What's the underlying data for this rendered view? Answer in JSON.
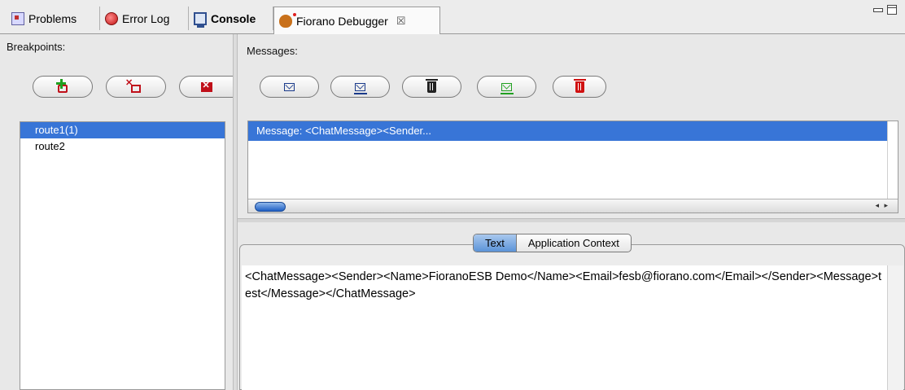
{
  "tabs": [
    {
      "label": "Problems",
      "icon": "problems-icon"
    },
    {
      "label": "Error Log",
      "icon": "error-log-icon"
    },
    {
      "label": "Console",
      "icon": "console-icon"
    },
    {
      "label": "Fiorano Debugger",
      "icon": "debugger-icon",
      "close": "☒"
    }
  ],
  "breakpoints": {
    "label": "Breakpoints:",
    "buttons": [
      "add-breakpoint-icon",
      "remove-breakpoint-icon",
      "remove-all-breakpoints-icon"
    ],
    "items": [
      "route1(1)",
      "route2"
    ],
    "selected_index": 0
  },
  "messages": {
    "label": "Messages:",
    "buttons": [
      "view-message-icon",
      "edit-message-icon",
      "delete-message-icon",
      "send-message-icon",
      "delete-all-messages-icon"
    ],
    "items": [
      "Message: <ChatMessage><Sender..."
    ],
    "scroll_arrows": "◂ ▸"
  },
  "detail": {
    "tabs": [
      "Text",
      "Application Context"
    ],
    "active_tab": "Text",
    "text": "<ChatMessage><Sender><Name>FioranoESB Demo</Name><Email>fesb@fiorano.com</Email></Sender><Message>test</Message></ChatMessage>"
  },
  "colors": {
    "selection": "#3875d7",
    "background": "#e8e8e8"
  }
}
